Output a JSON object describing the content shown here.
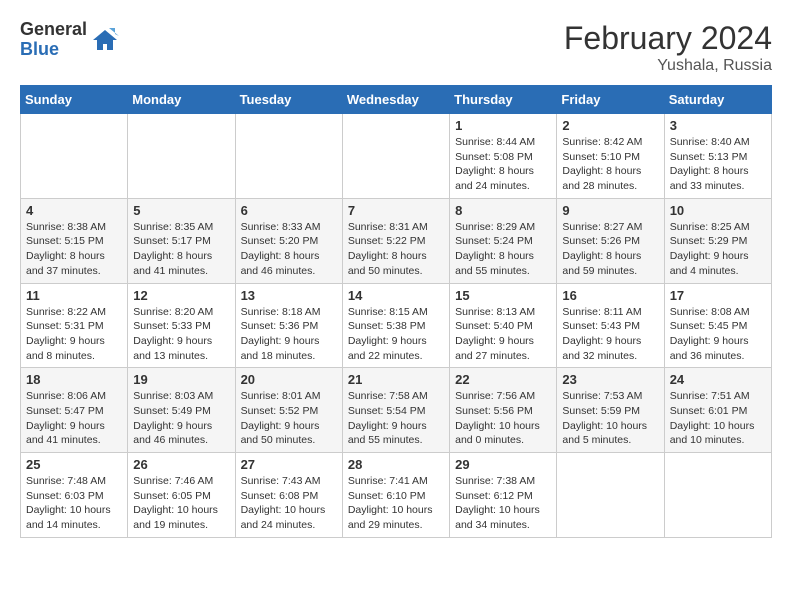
{
  "logo": {
    "general": "General",
    "blue": "Blue"
  },
  "title": "February 2024",
  "location": "Yushala, Russia",
  "days_of_week": [
    "Sunday",
    "Monday",
    "Tuesday",
    "Wednesday",
    "Thursday",
    "Friday",
    "Saturday"
  ],
  "weeks": [
    [
      {
        "day": "",
        "info": ""
      },
      {
        "day": "",
        "info": ""
      },
      {
        "day": "",
        "info": ""
      },
      {
        "day": "",
        "info": ""
      },
      {
        "day": "1",
        "info": "Sunrise: 8:44 AM\nSunset: 5:08 PM\nDaylight: 8 hours\nand 24 minutes."
      },
      {
        "day": "2",
        "info": "Sunrise: 8:42 AM\nSunset: 5:10 PM\nDaylight: 8 hours\nand 28 minutes."
      },
      {
        "day": "3",
        "info": "Sunrise: 8:40 AM\nSunset: 5:13 PM\nDaylight: 8 hours\nand 33 minutes."
      }
    ],
    [
      {
        "day": "4",
        "info": "Sunrise: 8:38 AM\nSunset: 5:15 PM\nDaylight: 8 hours\nand 37 minutes."
      },
      {
        "day": "5",
        "info": "Sunrise: 8:35 AM\nSunset: 5:17 PM\nDaylight: 8 hours\nand 41 minutes."
      },
      {
        "day": "6",
        "info": "Sunrise: 8:33 AM\nSunset: 5:20 PM\nDaylight: 8 hours\nand 46 minutes."
      },
      {
        "day": "7",
        "info": "Sunrise: 8:31 AM\nSunset: 5:22 PM\nDaylight: 8 hours\nand 50 minutes."
      },
      {
        "day": "8",
        "info": "Sunrise: 8:29 AM\nSunset: 5:24 PM\nDaylight: 8 hours\nand 55 minutes."
      },
      {
        "day": "9",
        "info": "Sunrise: 8:27 AM\nSunset: 5:26 PM\nDaylight: 8 hours\nand 59 minutes."
      },
      {
        "day": "10",
        "info": "Sunrise: 8:25 AM\nSunset: 5:29 PM\nDaylight: 9 hours\nand 4 minutes."
      }
    ],
    [
      {
        "day": "11",
        "info": "Sunrise: 8:22 AM\nSunset: 5:31 PM\nDaylight: 9 hours\nand 8 minutes."
      },
      {
        "day": "12",
        "info": "Sunrise: 8:20 AM\nSunset: 5:33 PM\nDaylight: 9 hours\nand 13 minutes."
      },
      {
        "day": "13",
        "info": "Sunrise: 8:18 AM\nSunset: 5:36 PM\nDaylight: 9 hours\nand 18 minutes."
      },
      {
        "day": "14",
        "info": "Sunrise: 8:15 AM\nSunset: 5:38 PM\nDaylight: 9 hours\nand 22 minutes."
      },
      {
        "day": "15",
        "info": "Sunrise: 8:13 AM\nSunset: 5:40 PM\nDaylight: 9 hours\nand 27 minutes."
      },
      {
        "day": "16",
        "info": "Sunrise: 8:11 AM\nSunset: 5:43 PM\nDaylight: 9 hours\nand 32 minutes."
      },
      {
        "day": "17",
        "info": "Sunrise: 8:08 AM\nSunset: 5:45 PM\nDaylight: 9 hours\nand 36 minutes."
      }
    ],
    [
      {
        "day": "18",
        "info": "Sunrise: 8:06 AM\nSunset: 5:47 PM\nDaylight: 9 hours\nand 41 minutes."
      },
      {
        "day": "19",
        "info": "Sunrise: 8:03 AM\nSunset: 5:49 PM\nDaylight: 9 hours\nand 46 minutes."
      },
      {
        "day": "20",
        "info": "Sunrise: 8:01 AM\nSunset: 5:52 PM\nDaylight: 9 hours\nand 50 minutes."
      },
      {
        "day": "21",
        "info": "Sunrise: 7:58 AM\nSunset: 5:54 PM\nDaylight: 9 hours\nand 55 minutes."
      },
      {
        "day": "22",
        "info": "Sunrise: 7:56 AM\nSunset: 5:56 PM\nDaylight: 10 hours\nand 0 minutes."
      },
      {
        "day": "23",
        "info": "Sunrise: 7:53 AM\nSunset: 5:59 PM\nDaylight: 10 hours\nand 5 minutes."
      },
      {
        "day": "24",
        "info": "Sunrise: 7:51 AM\nSunset: 6:01 PM\nDaylight: 10 hours\nand 10 minutes."
      }
    ],
    [
      {
        "day": "25",
        "info": "Sunrise: 7:48 AM\nSunset: 6:03 PM\nDaylight: 10 hours\nand 14 minutes."
      },
      {
        "day": "26",
        "info": "Sunrise: 7:46 AM\nSunset: 6:05 PM\nDaylight: 10 hours\nand 19 minutes."
      },
      {
        "day": "27",
        "info": "Sunrise: 7:43 AM\nSunset: 6:08 PM\nDaylight: 10 hours\nand 24 minutes."
      },
      {
        "day": "28",
        "info": "Sunrise: 7:41 AM\nSunset: 6:10 PM\nDaylight: 10 hours\nand 29 minutes."
      },
      {
        "day": "29",
        "info": "Sunrise: 7:38 AM\nSunset: 6:12 PM\nDaylight: 10 hours\nand 34 minutes."
      },
      {
        "day": "",
        "info": ""
      },
      {
        "day": "",
        "info": ""
      }
    ]
  ]
}
